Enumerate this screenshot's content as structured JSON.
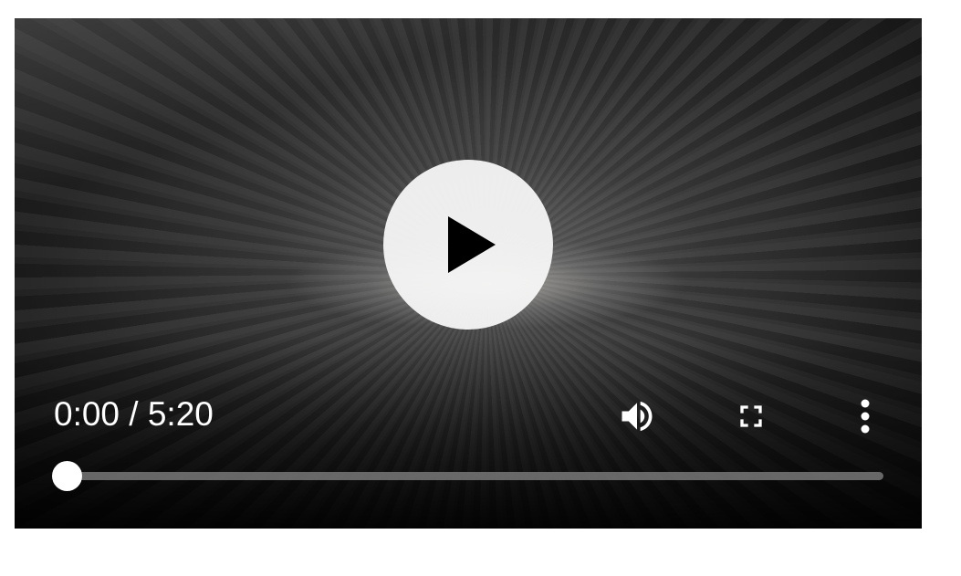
{
  "player": {
    "current_time": "0:00",
    "separator": "/",
    "duration": "5:20",
    "progress_fraction": 0.0
  },
  "icons": {
    "play": "play-icon",
    "volume": "volume-icon",
    "fullscreen": "fullscreen-icon",
    "menu": "more-vertical-icon"
  },
  "colors": {
    "controls": "#ffffff",
    "play_button_bg": "#f8f8f8",
    "track": "#787878"
  }
}
